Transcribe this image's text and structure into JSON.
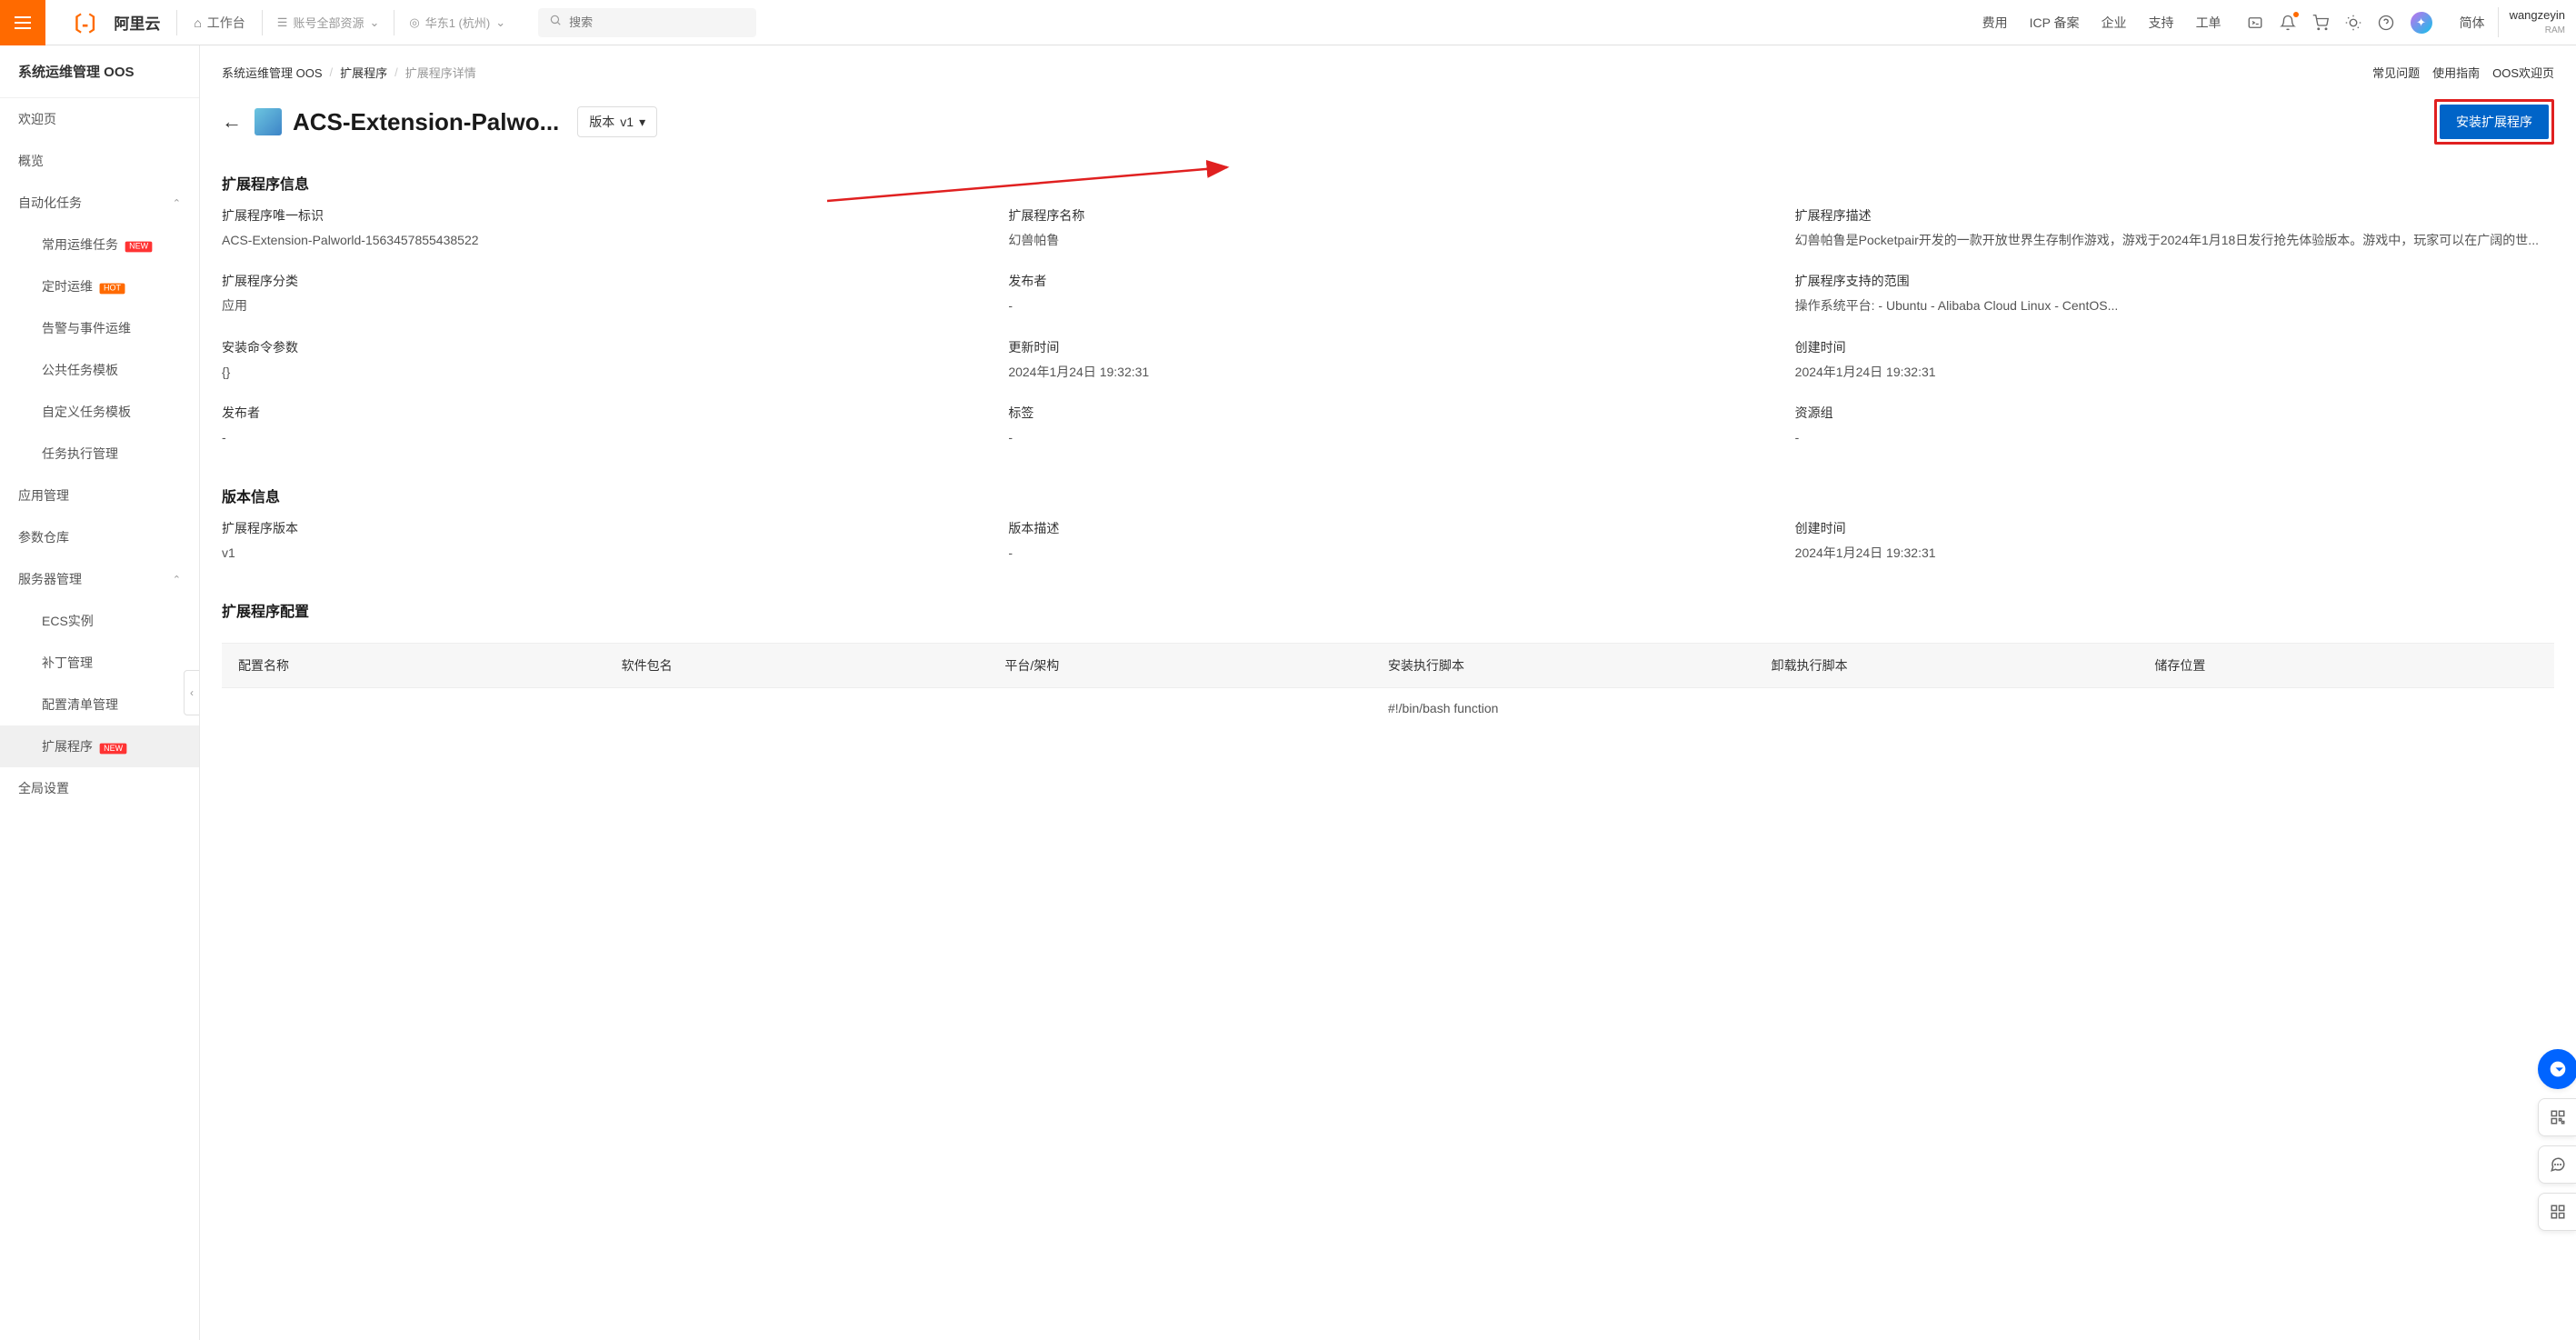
{
  "topbar": {
    "logo": "阿里云",
    "workspace": "工作台",
    "resource": "账号全部资源",
    "region": "华东1 (杭州)",
    "search_placeholder": "搜索",
    "nav": [
      "费用",
      "ICP 备案",
      "企业",
      "支持",
      "工单"
    ],
    "lang": "简体",
    "user": "wangzeyin",
    "user_sub": "RAM"
  },
  "sidebar": {
    "title": "系统运维管理 OOS",
    "items": [
      {
        "label": "欢迎页",
        "type": "item"
      },
      {
        "label": "概览",
        "type": "item"
      },
      {
        "label": "自动化任务",
        "type": "group",
        "expanded": true
      },
      {
        "label": "常用运维任务",
        "type": "sub",
        "badge": "NEW"
      },
      {
        "label": "定时运维",
        "type": "sub",
        "badge": "HOT"
      },
      {
        "label": "告警与事件运维",
        "type": "sub"
      },
      {
        "label": "公共任务模板",
        "type": "sub"
      },
      {
        "label": "自定义任务模板",
        "type": "sub"
      },
      {
        "label": "任务执行管理",
        "type": "sub"
      },
      {
        "label": "应用管理",
        "type": "item"
      },
      {
        "label": "参数仓库",
        "type": "item"
      },
      {
        "label": "服务器管理",
        "type": "group",
        "expanded": true
      },
      {
        "label": "ECS实例",
        "type": "sub"
      },
      {
        "label": "补丁管理",
        "type": "sub"
      },
      {
        "label": "配置清单管理",
        "type": "sub"
      },
      {
        "label": "扩展程序",
        "type": "sub",
        "badge": "NEW",
        "active": true
      },
      {
        "label": "全局设置",
        "type": "item"
      }
    ]
  },
  "breadcrumb": {
    "items": [
      "系统运维管理 OOS",
      "扩展程序",
      "扩展程序详情"
    ],
    "links": [
      "常见问题",
      "使用指南",
      "OOS欢迎页"
    ]
  },
  "header": {
    "title": "ACS-Extension-Palwo...",
    "version_label": "版本",
    "version_value": "v1",
    "install_btn": "安装扩展程序"
  },
  "section_info": {
    "title": "扩展程序信息",
    "items": [
      {
        "label": "扩展程序唯一标识",
        "value": "ACS-Extension-Palworld-1563457855438522"
      },
      {
        "label": "扩展程序名称",
        "value": "幻兽帕鲁"
      },
      {
        "label": "扩展程序描述",
        "value": "幻兽帕鲁是Pocketpair开发的一款开放世界生存制作游戏，游戏于2024年1月18日发行抢先体验版本。游戏中，玩家可以在广阔的世..."
      },
      {
        "label": "扩展程序分类",
        "value": "应用"
      },
      {
        "label": "发布者",
        "value": "-"
      },
      {
        "label": "扩展程序支持的范围",
        "value": "操作系统平台: - Ubuntu - Alibaba Cloud Linux - CentOS..."
      },
      {
        "label": "安装命令参数",
        "value": "{}"
      },
      {
        "label": "更新时间",
        "value": "2024年1月24日 19:32:31"
      },
      {
        "label": "创建时间",
        "value": "2024年1月24日 19:32:31"
      },
      {
        "label": "发布者",
        "value": "-"
      },
      {
        "label": "标签",
        "value": "-"
      },
      {
        "label": "资源组",
        "value": "-"
      }
    ]
  },
  "section_version": {
    "title": "版本信息",
    "items": [
      {
        "label": "扩展程序版本",
        "value": "v1"
      },
      {
        "label": "版本描述",
        "value": "-"
      },
      {
        "label": "创建时间",
        "value": "2024年1月24日 19:32:31"
      }
    ]
  },
  "section_config": {
    "title": "扩展程序配置",
    "headers": [
      "配置名称",
      "软件包名",
      "平台/架构",
      "安装执行脚本",
      "卸载执行脚本",
      "储存位置"
    ],
    "row": [
      "",
      "",
      "",
      "#!/bin/bash function",
      "",
      ""
    ]
  }
}
